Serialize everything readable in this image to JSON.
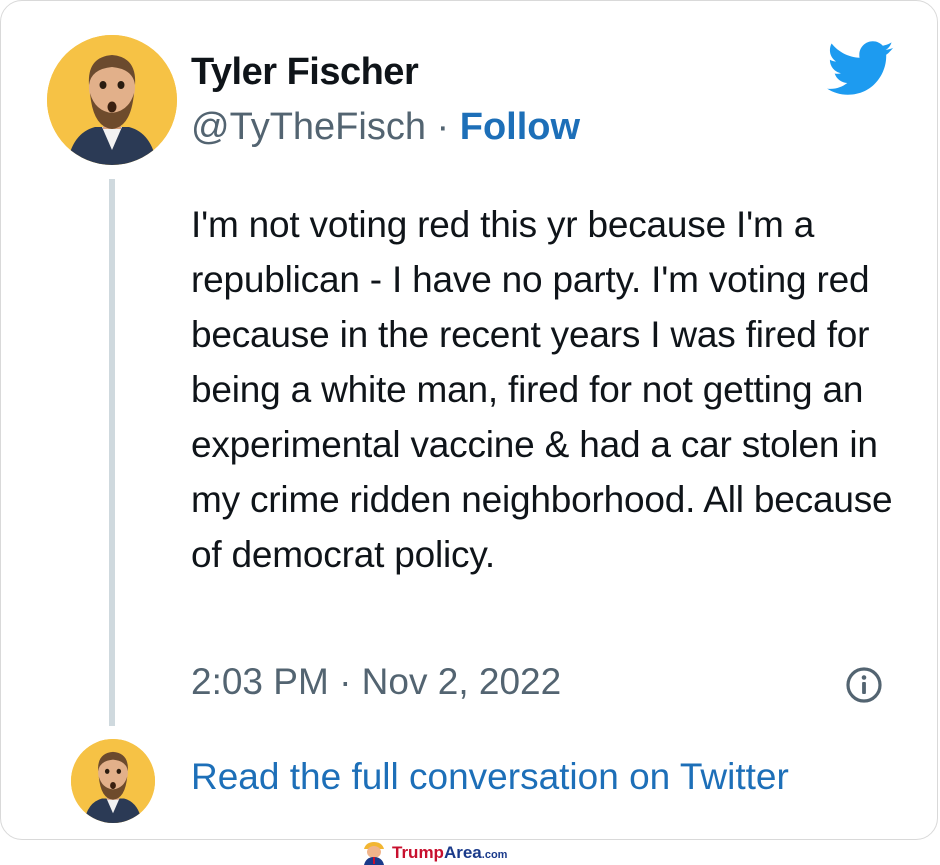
{
  "tweet": {
    "author_name": "Tyler Fischer",
    "handle": "@TyTheFisch",
    "separator": " · ",
    "follow_label": "Follow",
    "text": "I'm not voting red this yr because I'm a republican - I have no party. I'm voting red because in the recent years I was fired for being a white man, fired for not getting an experimental vaccine & had a car stolen in my crime ridden neighborhood. All because of democrat policy.",
    "timestamp": "2:03 PM · Nov 2, 2022",
    "read_full_label": "Read the full conversation on Twitter"
  },
  "icons": {
    "brand": "twitter-bird-icon",
    "info": "info-icon"
  },
  "colors": {
    "twitter_blue": "#1d9bf0",
    "link_blue": "#1d6fb8",
    "text": "#0f1419",
    "muted": "#536471",
    "avatar_bg": "#f6c245"
  },
  "watermark": {
    "brand_part1": "Trump",
    "brand_part2": "Area",
    "brand_suffix": ".com"
  }
}
